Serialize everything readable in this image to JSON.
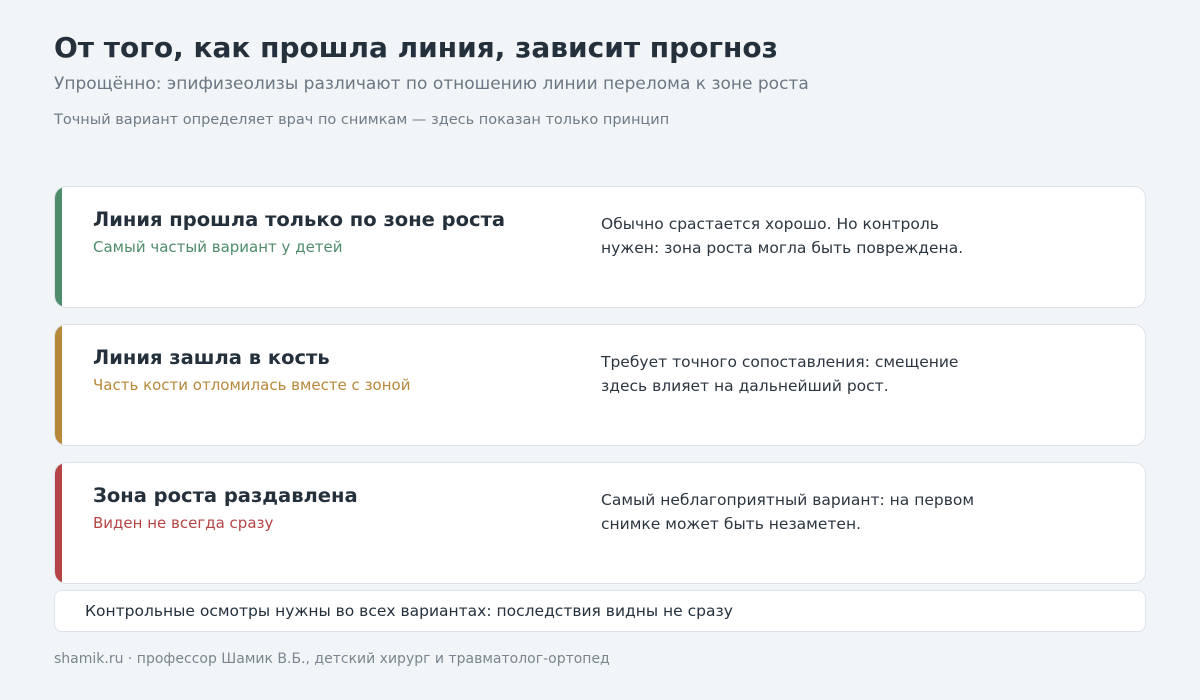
{
  "header": {
    "title": "От того, как прошла линия, зависит прогноз",
    "subtitle": "Упрощённо: эпифизеолизы различают по отношению линии перелома к зоне роста",
    "note": "Точный вариант определяет врач по снимкам — здесь показан только принцип"
  },
  "cards": [
    {
      "title": "Линия прошла только по зоне роста",
      "subtitle": "Самый частый вариант у детей",
      "description": "Обычно срастается хорошо. Но контроль нужен: зона роста могла быть повреждена.",
      "accent_color": "#4e8c6c"
    },
    {
      "title": "Линия зашла в кость",
      "subtitle": "Часть кости отломилась вместе с зоной",
      "description": "Требует точного сопоставления: смещение здесь влияет на дальнейший рост.",
      "accent_color": "#b8883a"
    },
    {
      "title": "Зона роста раздавлена",
      "subtitle": "Виден не всегда сразу",
      "description": "Самый неблагоприятный вариант: на первом снимке может быть незаметен.",
      "accent_color": "#b54545"
    }
  ],
  "footer": {
    "note": "Контрольные осмотры нужны во всех вариантах: последствия видны не сразу",
    "credit": "shamik.ru · профессор Шамик В.Б., детский хирург и травматолог-ортопед"
  }
}
